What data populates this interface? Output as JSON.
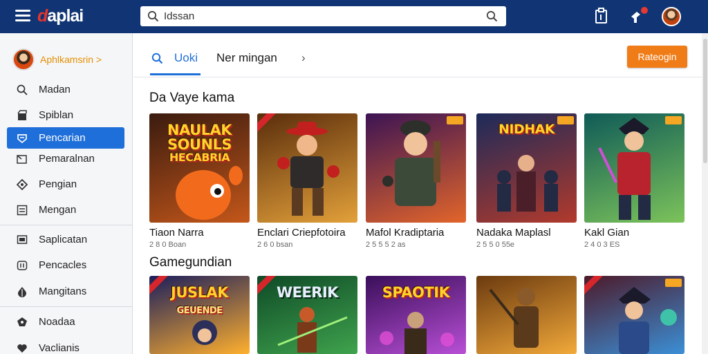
{
  "app": {
    "logo_lead": "d",
    "logo_rest": "aplai"
  },
  "search": {
    "value": "Idssan",
    "placeholder": ""
  },
  "topbar": {
    "icons": [
      "menu-icon",
      "search-icon",
      "clipboard-icon",
      "notification-icon",
      "avatar"
    ]
  },
  "sidebar": {
    "profile_name": "Aphlkamsrin",
    "profile_chevron": ">",
    "items": [
      {
        "label": "Madan",
        "icon": "search-icon"
      },
      {
        "label": "Spiblan",
        "icon": "store-icon"
      },
      {
        "label": "Pencarian",
        "icon": "shield-icon",
        "active": true
      },
      {
        "label": "Pemaralnan",
        "icon": "folder-icon"
      },
      {
        "label": "Pengian",
        "icon": "diamond-icon"
      },
      {
        "label": "Mengan",
        "icon": "list-icon"
      },
      {
        "label": "Saplicatan",
        "icon": "screen-icon"
      },
      {
        "label": "Pencacles",
        "icon": "gamepad-icon"
      },
      {
        "label": "Mangitans",
        "icon": "drop-icon"
      },
      {
        "label": "Noadaa",
        "icon": "shield-star-icon"
      },
      {
        "label": "Vaclianis",
        "icon": "heart-icon"
      }
    ]
  },
  "tabs": {
    "items": [
      "Uoki",
      "Ner mingan"
    ],
    "next": "›"
  },
  "cta_label": "Rateogin",
  "sections": [
    {
      "title": "Da Vaye kama",
      "cards": [
        {
          "name": "Tiaon Narra",
          "meta": "2 8 0 Boan",
          "art": "NAULAK SOUNLS",
          "art_sub": "HECABRIA",
          "bg": [
            "#3a1b0f",
            "#c4571a"
          ]
        },
        {
          "name": "Enclari Criepfotoira",
          "meta": "2 6 0 bsan",
          "art": "",
          "bg": [
            "#5a2d0c",
            "#e3a13a"
          ]
        },
        {
          "name": "Mafol Kradiptaria",
          "meta": "2 5 5 5 2 as",
          "art": "",
          "bg": [
            "#3c1454",
            "#e2652a"
          ]
        },
        {
          "name": "Nadaka Maplasl",
          "meta": "2 5 5 0 55e",
          "art": "NIDHAK",
          "art_sub": "",
          "bg": [
            "#1c2a5a",
            "#b23a2c"
          ]
        },
        {
          "name": "Kakl Gian",
          "meta": "2 4 0 3 ES",
          "art": "",
          "bg": [
            "#0f5b57",
            "#7cc35a"
          ]
        }
      ]
    },
    {
      "title": "Gamegundian",
      "cards": [
        {
          "name": "",
          "meta": "",
          "art": "JUSLAK",
          "art_sub": "GEUENDE",
          "bg": [
            "#1b1e5c",
            "#ffb02e"
          ]
        },
        {
          "name": "",
          "meta": "",
          "art": "WEERIK",
          "art_sub": "",
          "bg": [
            "#0f4a27",
            "#3fa34d"
          ]
        },
        {
          "name": "",
          "meta": "",
          "art": "SPAOTIK",
          "art_sub": "",
          "bg": [
            "#3a0f5a",
            "#b84fd6"
          ]
        },
        {
          "name": "",
          "meta": "",
          "art": "",
          "art_sub": "",
          "bg": [
            "#6b3a0f",
            "#f2a93a"
          ]
        },
        {
          "name": "",
          "meta": "",
          "art": "",
          "art_sub": "",
          "bg": [
            "#4d1a2a",
            "#3b8fd6"
          ]
        }
      ]
    }
  ],
  "colors": {
    "topbar": "#113574",
    "accent": "#1e6fd9",
    "cta": "#f07c17",
    "badge": "#f5a623"
  }
}
